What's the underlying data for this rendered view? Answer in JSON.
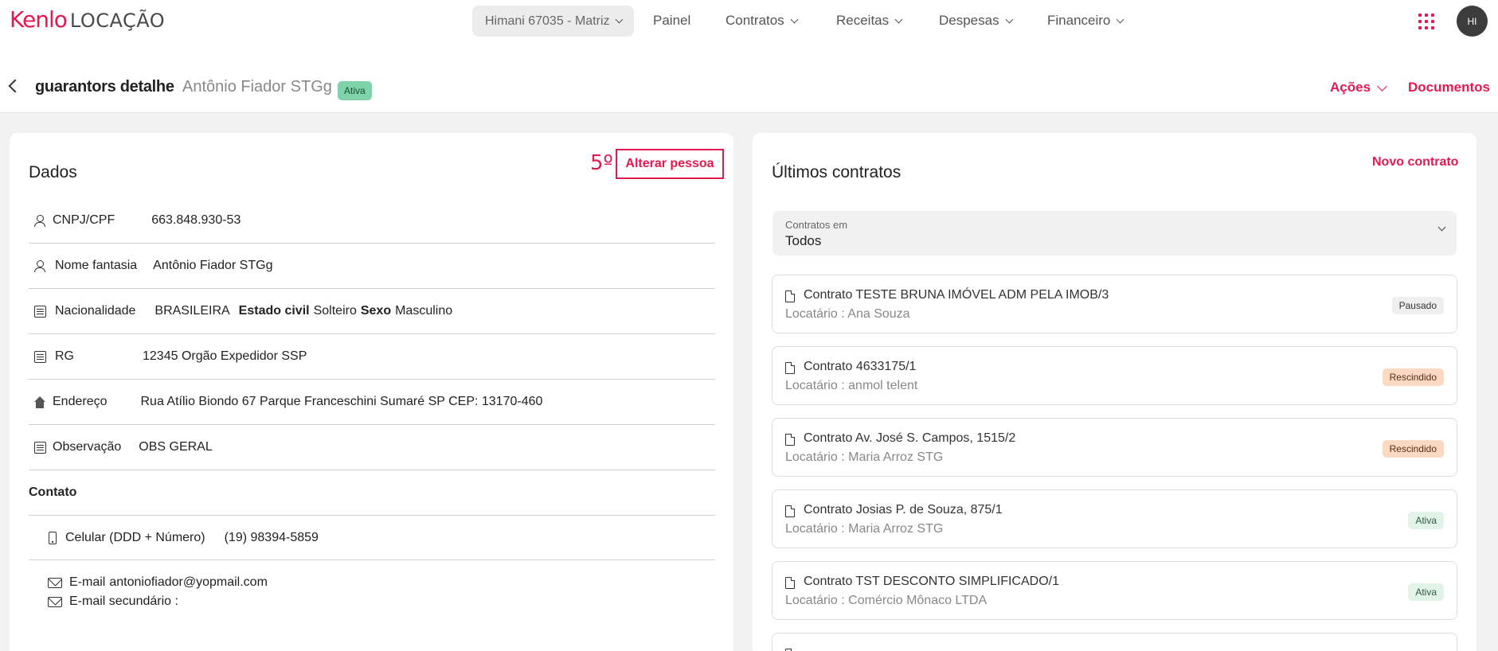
{
  "colors": {
    "accent": "#e5194f",
    "status_ativa": "#7ed3a8"
  },
  "topbar": {
    "logo_brand": "Kenlo",
    "logo_product": "LOCAÇÃO",
    "unit_selector": "Himani 67035 - Matriz",
    "nav": [
      {
        "label": "Painel"
      },
      {
        "label": "Contratos"
      },
      {
        "label": "Receitas"
      },
      {
        "label": "Despesas"
      },
      {
        "label": "Financeiro"
      }
    ],
    "apps_icon": "apps-grid-icon",
    "avatar_initials": "HI"
  },
  "header": {
    "title": "guarantors detalhe",
    "person_name": "Antônio Fiador STGg",
    "status": "Ativa",
    "actions_label": "Ações",
    "documents_label": "Documentos"
  },
  "dados": {
    "title": "Dados",
    "step_marker": "5º",
    "alter_button": "Alterar pessoa",
    "cnpj_label": "CNPJ/CPF",
    "cnpj_value": "663.848.930-53",
    "fantasia_label": "Nome fantasia",
    "fantasia_value": "Antônio Fiador STGg",
    "nacionalidade_label": "Nacionalidade",
    "nacionalidade_value": "BRASILEIRA",
    "estado_civil_label": "Estado civil",
    "estado_civil_value": "Solteiro",
    "sexo_label": "Sexo",
    "sexo_value": "Masculino",
    "rg_label": "RG",
    "rg_value": "12345 Orgão Expedidor SSP",
    "endereco_label": "Endereço",
    "endereco_value": "Rua Atílio Biondo 67 Parque Franceschini Sumaré SP CEP: 13170-460",
    "observacao_label": "Observação",
    "observacao_value": "OBS GERAL",
    "contato_title": "Contato",
    "celular_label": "Celular (DDD + Número)",
    "celular_value": "(19) 98394-5859",
    "email_label": "E-mail",
    "email_value": "antoniofiador@yopmail.com",
    "email2_label": "E-mail secundário :"
  },
  "contratos": {
    "title": "Últimos contratos",
    "new_button": "Novo contrato",
    "filter_label": "Contratos em",
    "filter_value": "Todos",
    "items": [
      {
        "title": "Contrato TESTE BRUNA IMÓVEL ADM PELA IMOB/3",
        "tenant": "Locatário : Ana Souza",
        "status": "Pausado"
      },
      {
        "title": "Contrato 4633175/1",
        "tenant": "Locatário : anmol telent",
        "status": "Rescindido"
      },
      {
        "title": "Contrato Av. José S. Campos, 1515/2",
        "tenant": "Locatário : Maria Arroz STG",
        "status": "Rescindido"
      },
      {
        "title": "Contrato Josias P. de Souza, 875/1",
        "tenant": "Locatário : Maria Arroz STG",
        "status": "Ativa"
      },
      {
        "title": "Contrato TST DESCONTO SIMPLIFICADO/1",
        "tenant": "Locatário : Comércio Mônaco LTDA",
        "status": "Ativa"
      }
    ]
  }
}
